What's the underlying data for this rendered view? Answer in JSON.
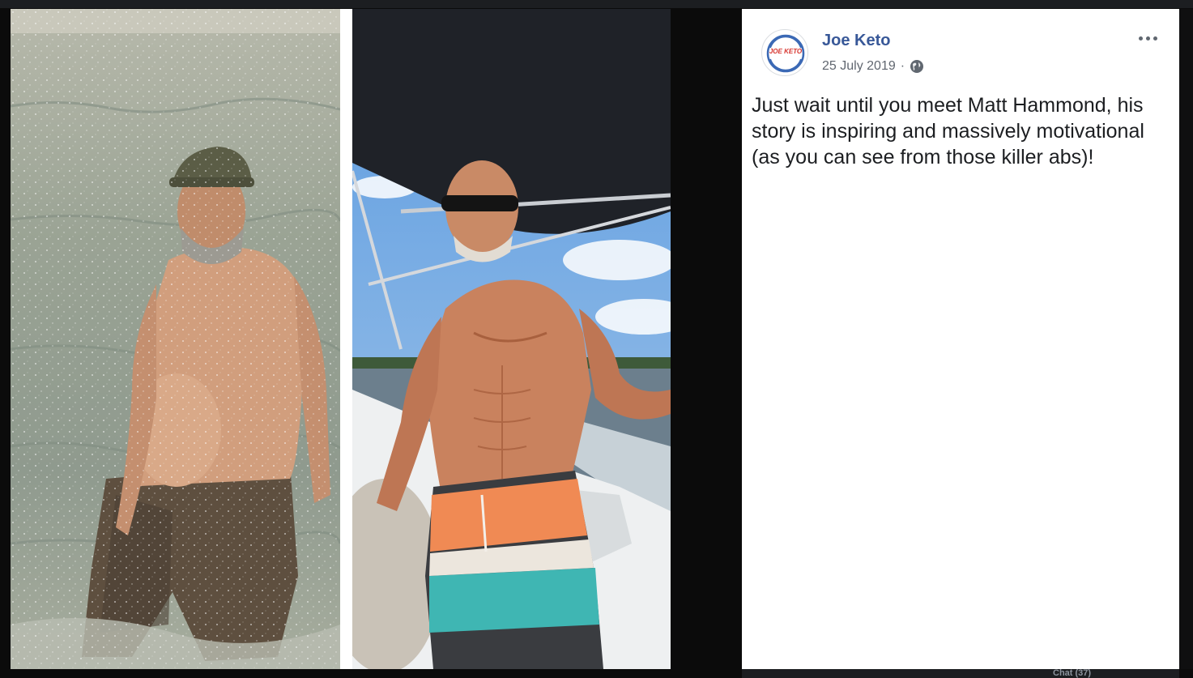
{
  "post": {
    "author": "Joe Keto",
    "avatar_text": "JOE KETO",
    "date": "25 July 2019",
    "separator": "·",
    "privacy_icon": "globe-icon",
    "more_icon": "more-options-icon",
    "text": "Just wait until you meet Matt Hammond, his story is inspiring and massively motivational (as you can see from those killer abs)!"
  },
  "photos": {
    "left_icon": "before-photo",
    "right_icon": "after-photo"
  },
  "background": {
    "chat_label": "Chat (37)"
  },
  "colors": {
    "author_link": "#385898",
    "meta_text": "#616770",
    "avatar_blue": "#3b69b5",
    "avatar_red": "#d6322c",
    "backdrop": "#0b0b0b"
  }
}
